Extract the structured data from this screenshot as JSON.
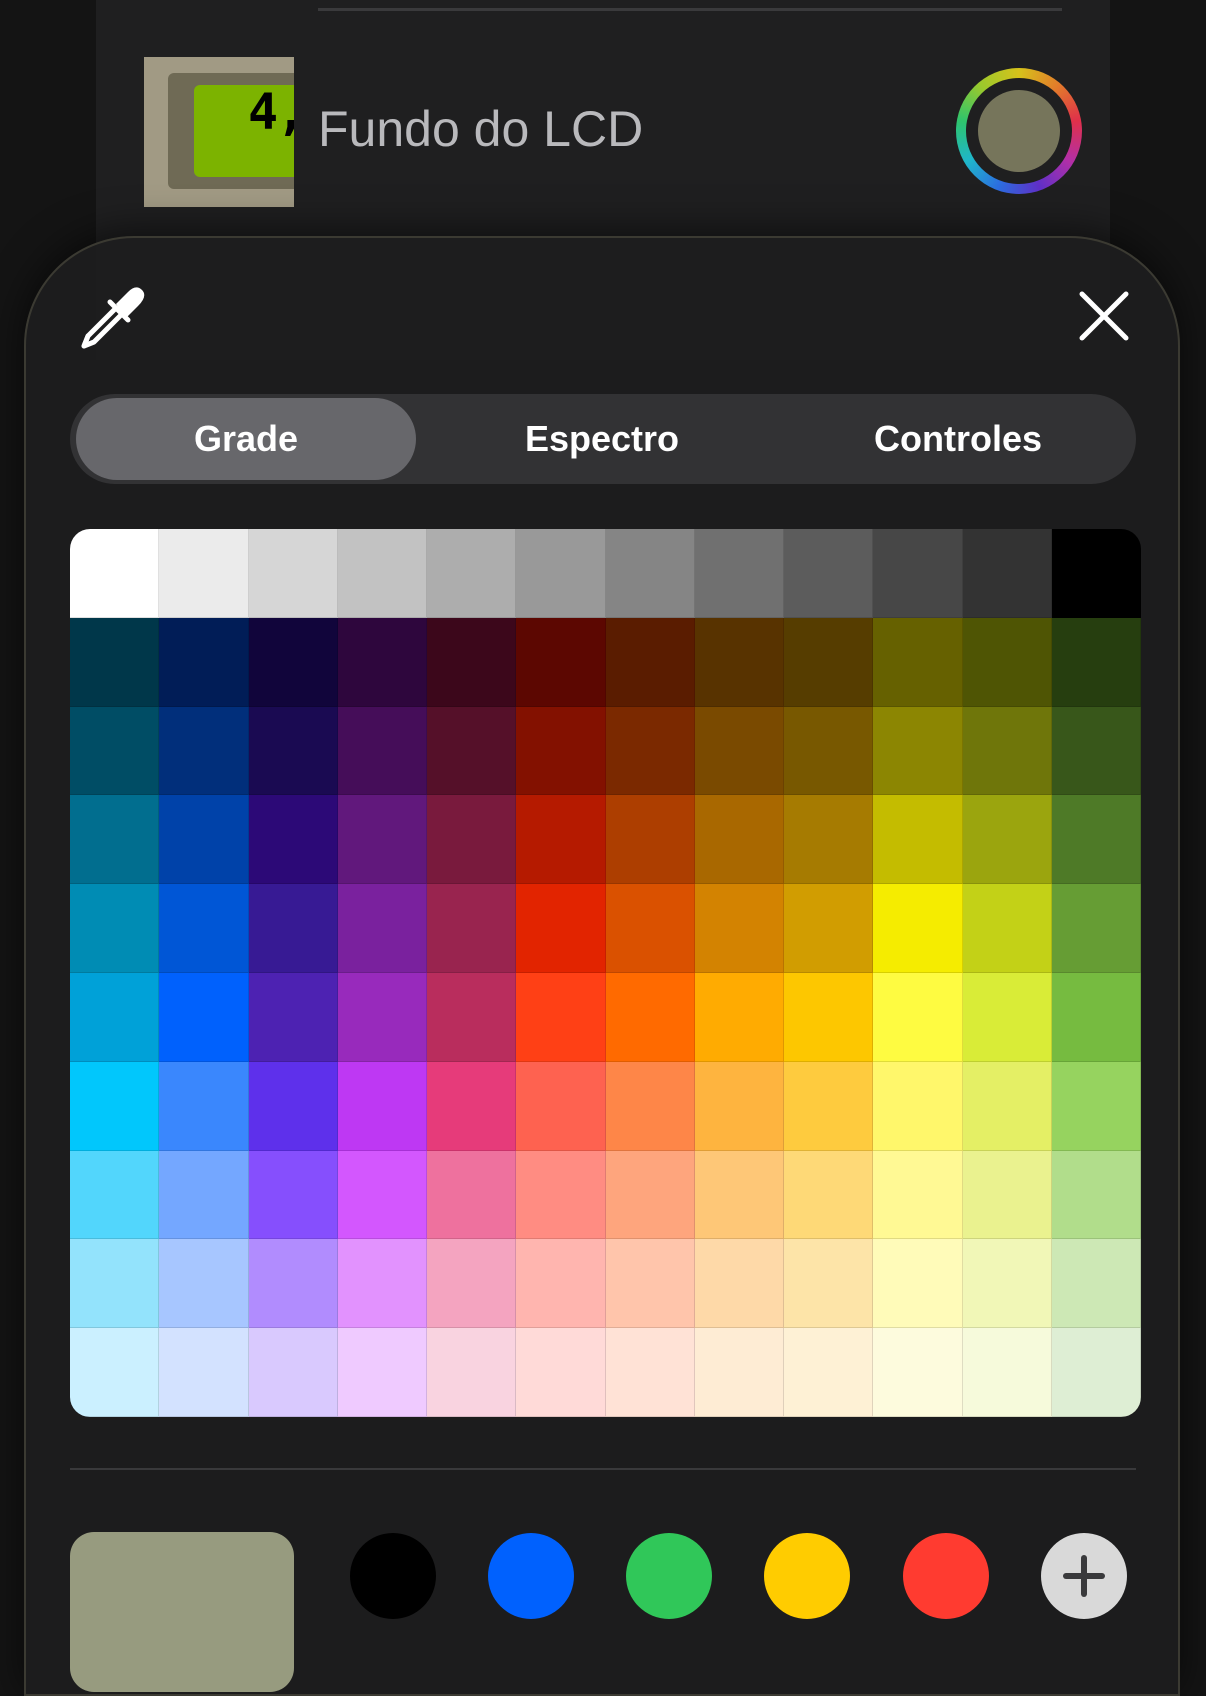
{
  "background_row": {
    "lcd_digits": "4,",
    "label": "Fundo do LCD",
    "current_color": "#76755b"
  },
  "picker": {
    "tabs": [
      {
        "label": "Grade",
        "selected": true
      },
      {
        "label": "Espectro",
        "selected": false
      },
      {
        "label": "Controles",
        "selected": false
      }
    ],
    "grid_colors": [
      [
        "#ffffff",
        "#ebebeb",
        "#d6d6d6",
        "#c2c2c2",
        "#adadad",
        "#999999",
        "#858585",
        "#707070",
        "#5c5c5c",
        "#474747",
        "#333333",
        "#000000"
      ],
      [
        "#00374a",
        "#011d57",
        "#11053b",
        "#2e063d",
        "#3c071b",
        "#5c0701",
        "#5a1c00",
        "#583300",
        "#563d00",
        "#666100",
        "#4f5504",
        "#263e0f"
      ],
      [
        "#004d65",
        "#012f7b",
        "#1a0a52",
        "#450d59",
        "#551029",
        "#831100",
        "#7b2900",
        "#7a4a00",
        "#785800",
        "#8c8602",
        "#6f760a",
        "#38571a"
      ],
      [
        "#016e8f",
        "#0042a9",
        "#2c0977",
        "#61187c",
        "#791a3d",
        "#b51a00",
        "#ad3e00",
        "#a96800",
        "#a67b01",
        "#c4bc00",
        "#9ba50e",
        "#4e7a27"
      ],
      [
        "#008cb4",
        "#0056d6",
        "#371a94",
        "#7a219e",
        "#99244f",
        "#e22400",
        "#da5100",
        "#d38301",
        "#d19d01",
        "#f5ec00",
        "#c3d117",
        "#669d34"
      ],
      [
        "#00a1d8",
        "#0061fd",
        "#4d22b2",
        "#982abc",
        "#b92d5d",
        "#ff4015",
        "#ff6a00",
        "#ffab01",
        "#fdc700",
        "#fefb41",
        "#d9ec37",
        "#76bb40"
      ],
      [
        "#01c7fc",
        "#3a87fd",
        "#5e30eb",
        "#be38f3",
        "#e63b7a",
        "#fe6250",
        "#fe8648",
        "#feb43f",
        "#fecb3e",
        "#fff76b",
        "#e4ef65",
        "#96d35f"
      ],
      [
        "#52d6fc",
        "#74a7ff",
        "#864ffd",
        "#d357fe",
        "#ee719e",
        "#ff8c82",
        "#fea57d",
        "#fec777",
        "#fed977",
        "#fff994",
        "#eaf28f",
        "#b1dd8b"
      ],
      [
        "#93e3fc",
        "#a7c6ff",
        "#b18cfe",
        "#e292fe",
        "#f4a4c0",
        "#ffb5af",
        "#ffc5ab",
        "#fed9a8",
        "#fde4a8",
        "#fffbb9",
        "#f1f7b7",
        "#cde8b5"
      ],
      [
        "#cbf0ff",
        "#d3e2ff",
        "#d9c9fe",
        "#efcaff",
        "#f9d3e0",
        "#ffdad8",
        "#ffe2d6",
        "#feecd4",
        "#fef1d5",
        "#fdfbdd",
        "#f6fadb",
        "#deeed4"
      ]
    ],
    "current_color": "#979b7f",
    "saved_colors": [
      "#000000",
      "#0061fe",
      "#30c759",
      "#ffcc00",
      "#ff3b30"
    ],
    "icons": {
      "eyedropper": "eyedropper-icon",
      "close": "close-icon",
      "add": "plus-icon"
    }
  }
}
